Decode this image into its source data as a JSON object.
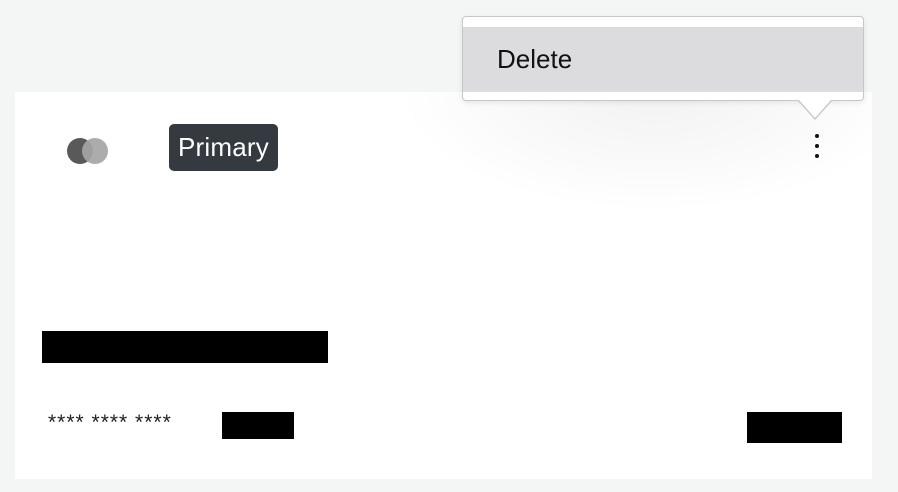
{
  "card": {
    "badge_label": "Primary",
    "masked_number": "**** **** ****",
    "brand_icon": "card-brand-logo",
    "menu_icon": "vertical-ellipsis"
  },
  "menu": {
    "items": [
      {
        "label": "Delete"
      }
    ]
  },
  "colors": {
    "page_background": "#f4f5f5",
    "card_background": "#ffffff",
    "badge_background": "#343a40",
    "menu_highlight": "#dcdcdf"
  }
}
